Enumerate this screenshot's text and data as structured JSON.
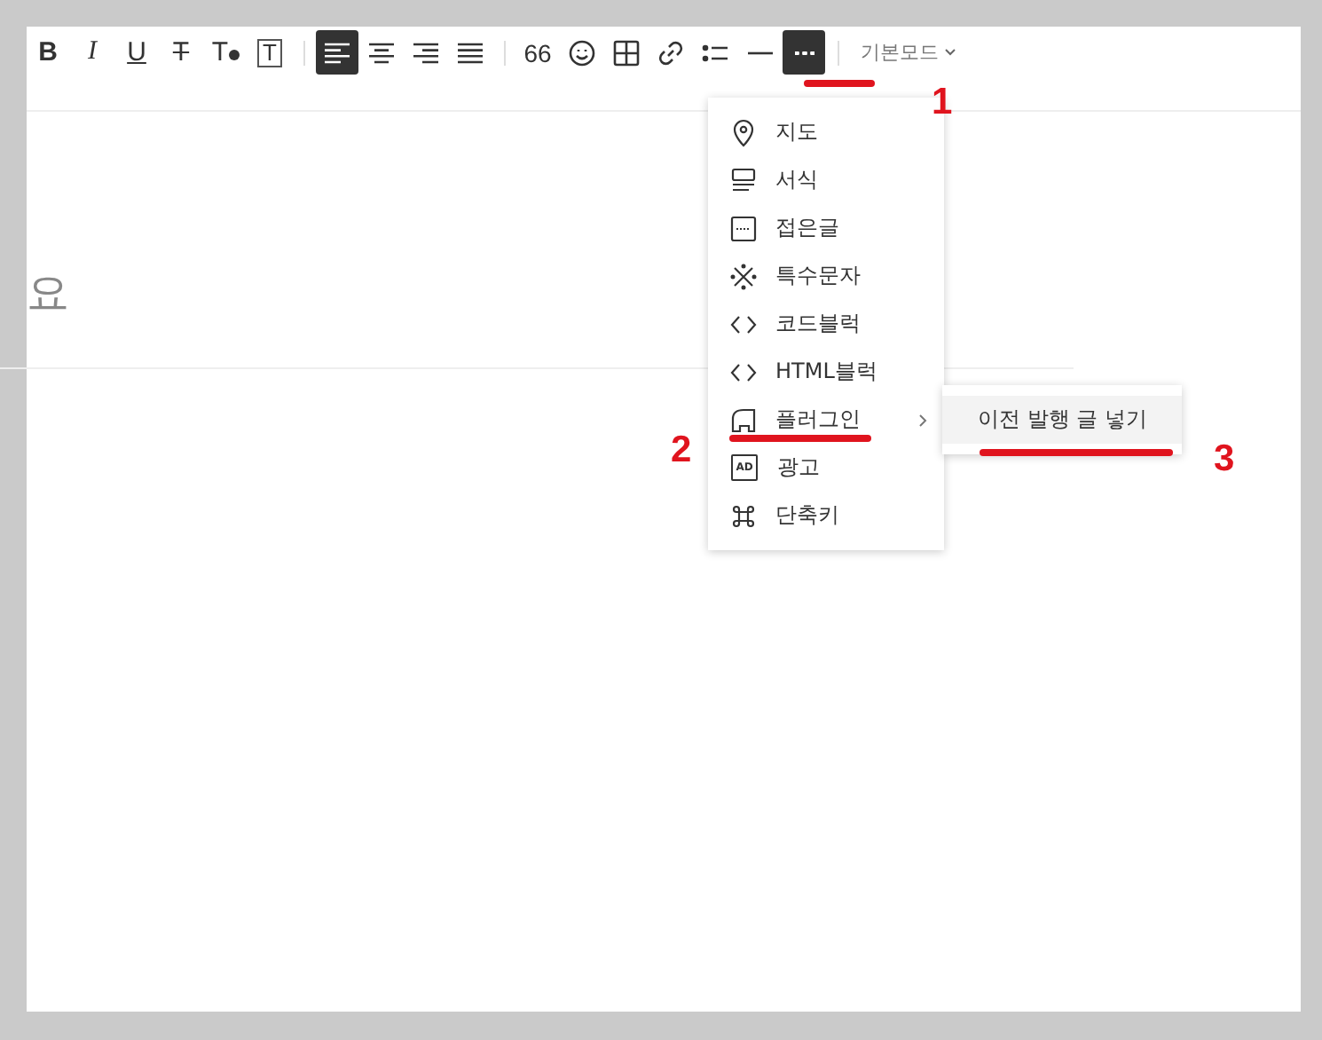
{
  "toolbar": {
    "items": [
      {
        "kind": "bold",
        "label": "B",
        "selected": false
      },
      {
        "kind": "italic",
        "label": "I",
        "selected": false
      },
      {
        "kind": "underline",
        "label": "U",
        "selected": false
      },
      {
        "kind": "strike",
        "label": "T",
        "selected": false
      },
      {
        "kind": "color",
        "label": "T",
        "selected": false
      },
      {
        "kind": "bg",
        "label": "T",
        "selected": false
      },
      {
        "kind": "sep"
      },
      {
        "kind": "align-left",
        "selected": true
      },
      {
        "kind": "align-center",
        "selected": false
      },
      {
        "kind": "align-right",
        "selected": false
      },
      {
        "kind": "align-justify",
        "selected": false
      },
      {
        "kind": "sep"
      },
      {
        "kind": "quote",
        "label": "66",
        "selected": false
      },
      {
        "kind": "emoji",
        "selected": false
      },
      {
        "kind": "table",
        "selected": false
      },
      {
        "kind": "link",
        "selected": false
      },
      {
        "kind": "list",
        "selected": false
      },
      {
        "kind": "hr",
        "selected": false
      },
      {
        "kind": "more",
        "selected": true
      },
      {
        "kind": "sep"
      }
    ],
    "mode": "기본모드"
  },
  "title_field": {
    "placeholder": "요"
  },
  "menu": {
    "items": [
      {
        "kind": "map",
        "label": "지도"
      },
      {
        "kind": "format",
        "label": "서식"
      },
      {
        "kind": "fold",
        "label": "접은글"
      },
      {
        "kind": "special",
        "label": "특수문자"
      },
      {
        "kind": "code",
        "label": "코드블럭"
      },
      {
        "kind": "code",
        "label": "HTML블럭"
      },
      {
        "kind": "plugin",
        "label": "플러그인",
        "submenu": true
      },
      {
        "kind": "ad",
        "label": "광고",
        "icon_text": "AD"
      },
      {
        "kind": "shortcut",
        "label": "단축키"
      }
    ]
  },
  "submenu": {
    "items": [
      {
        "label": "이전 발행 글 넣기",
        "selected": true
      }
    ]
  },
  "annotations": [
    "1",
    "2",
    "3"
  ]
}
